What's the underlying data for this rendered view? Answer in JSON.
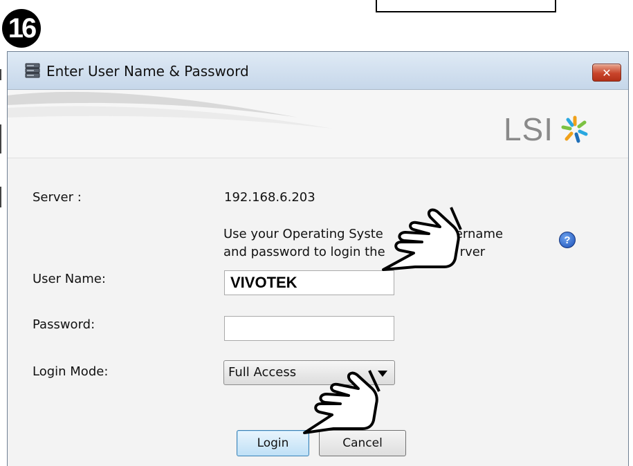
{
  "step": {
    "number": "16"
  },
  "window": {
    "title": "Enter User Name & Password",
    "close_label": "✕"
  },
  "banner": {
    "logo_text": "LSI"
  },
  "form": {
    "server_label": "Server :",
    "server_value": "192.168.6.203",
    "info_line1": "Use your Operating Syste",
    "info_line1b": "ername",
    "info_line2": "and password to login the",
    "info_line2b": "rver",
    "help_label": "?",
    "username_label": "User Name:",
    "username_value": "VIVOTEK",
    "password_label": "Password:",
    "password_value": "",
    "login_mode_label": "Login Mode:",
    "login_mode_value": "Full Access"
  },
  "buttons": {
    "login": "Login",
    "cancel": "Cancel"
  },
  "colors": {
    "titlebar": "#c6d7ea",
    "close": "#c9452b",
    "login_border": "#3c7fb1",
    "help": "#1a4fb6"
  },
  "icons": [
    "app-server-icon",
    "close-icon",
    "lsi-logo-icon",
    "help-icon",
    "dropdown-arrow-icon",
    "pointing-hand-icon"
  ]
}
